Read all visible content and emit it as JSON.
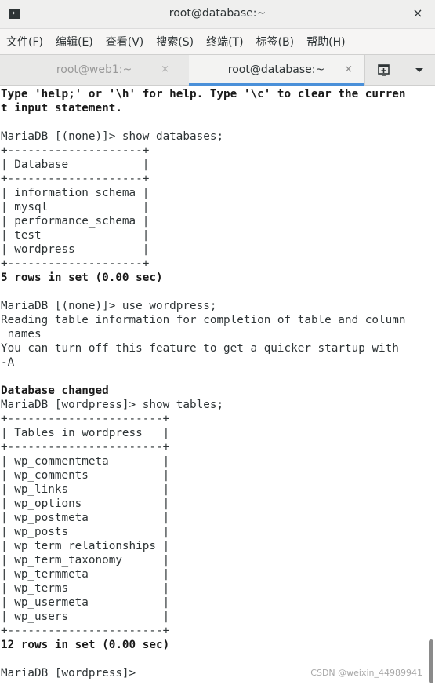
{
  "window": {
    "title": "root@database:~",
    "close_label": "×"
  },
  "menubar": {
    "items": [
      {
        "label": "文件(F)"
      },
      {
        "label": "编辑(E)"
      },
      {
        "label": "查看(V)"
      },
      {
        "label": "搜索(S)"
      },
      {
        "label": "终端(T)"
      },
      {
        "label": "标签(B)"
      },
      {
        "label": "帮助(H)"
      }
    ]
  },
  "tabs": [
    {
      "label": "root@web1:~",
      "close": "×",
      "active": false
    },
    {
      "label": "root@database:~",
      "close": "×",
      "active": true
    }
  ],
  "terminal": {
    "lines": [
      {
        "text": "Type 'help;' or '\\h' for help. Type '\\c' to clear the curren",
        "bold": true
      },
      {
        "text": "t input statement.",
        "bold": true
      },
      {
        "text": "",
        "bold": false
      },
      {
        "text": "MariaDB [(none)]> show databases;",
        "bold": false
      },
      {
        "text": "+--------------------+",
        "bold": false
      },
      {
        "text": "| Database           |",
        "bold": false
      },
      {
        "text": "+--------------------+",
        "bold": false
      },
      {
        "text": "| information_schema |",
        "bold": false
      },
      {
        "text": "| mysql              |",
        "bold": false
      },
      {
        "text": "| performance_schema |",
        "bold": false
      },
      {
        "text": "| test               |",
        "bold": false
      },
      {
        "text": "| wordpress          |",
        "bold": false
      },
      {
        "text": "+--------------------+",
        "bold": false
      },
      {
        "text": "5 rows in set (0.00 sec)",
        "bold": true
      },
      {
        "text": "",
        "bold": false
      },
      {
        "text": "MariaDB [(none)]> use wordpress;",
        "bold": false
      },
      {
        "text": "Reading table information for completion of table and column",
        "bold": false
      },
      {
        "text": " names",
        "bold": false
      },
      {
        "text": "You can turn off this feature to get a quicker startup with",
        "bold": false
      },
      {
        "text": "-A",
        "bold": false
      },
      {
        "text": "",
        "bold": false
      },
      {
        "text": "Database changed",
        "bold": true
      },
      {
        "text": "MariaDB [wordpress]> show tables;",
        "bold": false
      },
      {
        "text": "+-----------------------+",
        "bold": false
      },
      {
        "text": "| Tables_in_wordpress   |",
        "bold": false
      },
      {
        "text": "+-----------------------+",
        "bold": false
      },
      {
        "text": "| wp_commentmeta        |",
        "bold": false
      },
      {
        "text": "| wp_comments           |",
        "bold": false
      },
      {
        "text": "| wp_links              |",
        "bold": false
      },
      {
        "text": "| wp_options            |",
        "bold": false
      },
      {
        "text": "| wp_postmeta           |",
        "bold": false
      },
      {
        "text": "| wp_posts              |",
        "bold": false
      },
      {
        "text": "| wp_term_relationships |",
        "bold": false
      },
      {
        "text": "| wp_term_taxonomy      |",
        "bold": false
      },
      {
        "text": "| wp_termmeta           |",
        "bold": false
      },
      {
        "text": "| wp_terms              |",
        "bold": false
      },
      {
        "text": "| wp_usermeta           |",
        "bold": false
      },
      {
        "text": "| wp_users              |",
        "bold": false
      },
      {
        "text": "+-----------------------+",
        "bold": false
      },
      {
        "text": "12 rows in set (0.00 sec)",
        "bold": true
      },
      {
        "text": "",
        "bold": false
      },
      {
        "text": "MariaDB [wordpress]> ",
        "bold": false
      }
    ]
  },
  "icons": {
    "app": "terminal-app-icon",
    "new_tab": "new-tab-icon",
    "dropdown": "chevron-down-icon"
  },
  "colors": {
    "active_tab_indicator": "#4a90d9",
    "terminal_fg": "#2e3436",
    "terminal_bg": "#ffffff"
  },
  "watermark": "CSDN @weixin_44989941"
}
